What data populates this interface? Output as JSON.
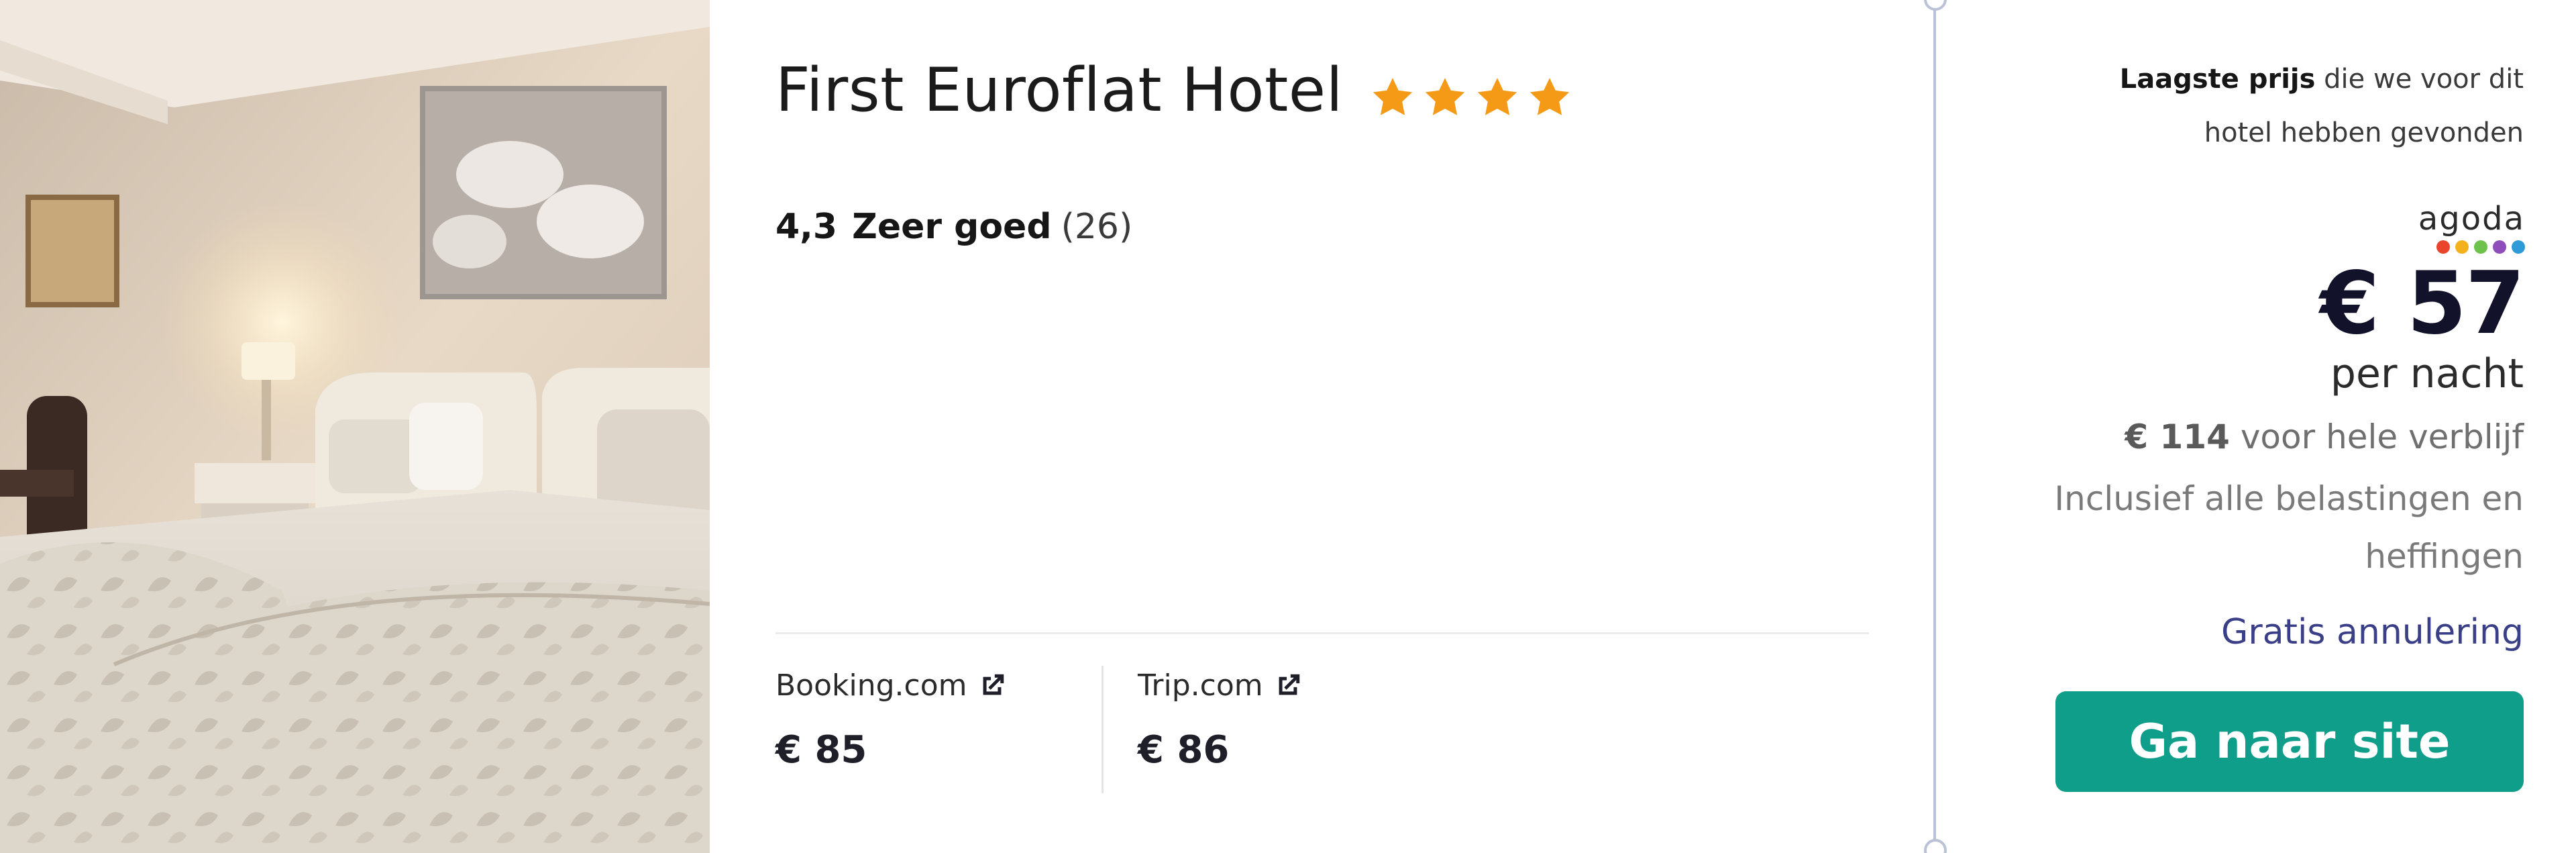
{
  "hotel": {
    "name": "First Euroflat Hotel",
    "star_count": 4,
    "rating_score": "4,3",
    "rating_label": "Zeer goed",
    "rating_count": "(26)"
  },
  "providers": [
    {
      "name": "Booking.com",
      "price": "€ 85"
    },
    {
      "name": "Trip.com",
      "price": "€ 86"
    }
  ],
  "price_panel": {
    "lowest_bold": "Laagste prijs",
    "lowest_rest": "die we voor dit hotel hebben gevonden",
    "provider_logo_text": "agoda",
    "price": "€ 57",
    "per_night": "per nacht",
    "total_amount": "€ 114",
    "total_suffix": "voor hele verblijf",
    "taxes": "Inclusief alle belastingen en heffingen",
    "free_cancellation": "Gratis annulering",
    "cta": "Ga naar site"
  },
  "colors": {
    "star": "#f59a16",
    "cta_background": "#0f9e89",
    "free_cancellation": "#3b3f88",
    "agoda_dots": [
      "#e8452c",
      "#f3b21b",
      "#6cc24a",
      "#8f4dbb",
      "#2f9ad8"
    ]
  },
  "icons": {
    "star": "star-icon",
    "external_link": "external-link-icon"
  }
}
